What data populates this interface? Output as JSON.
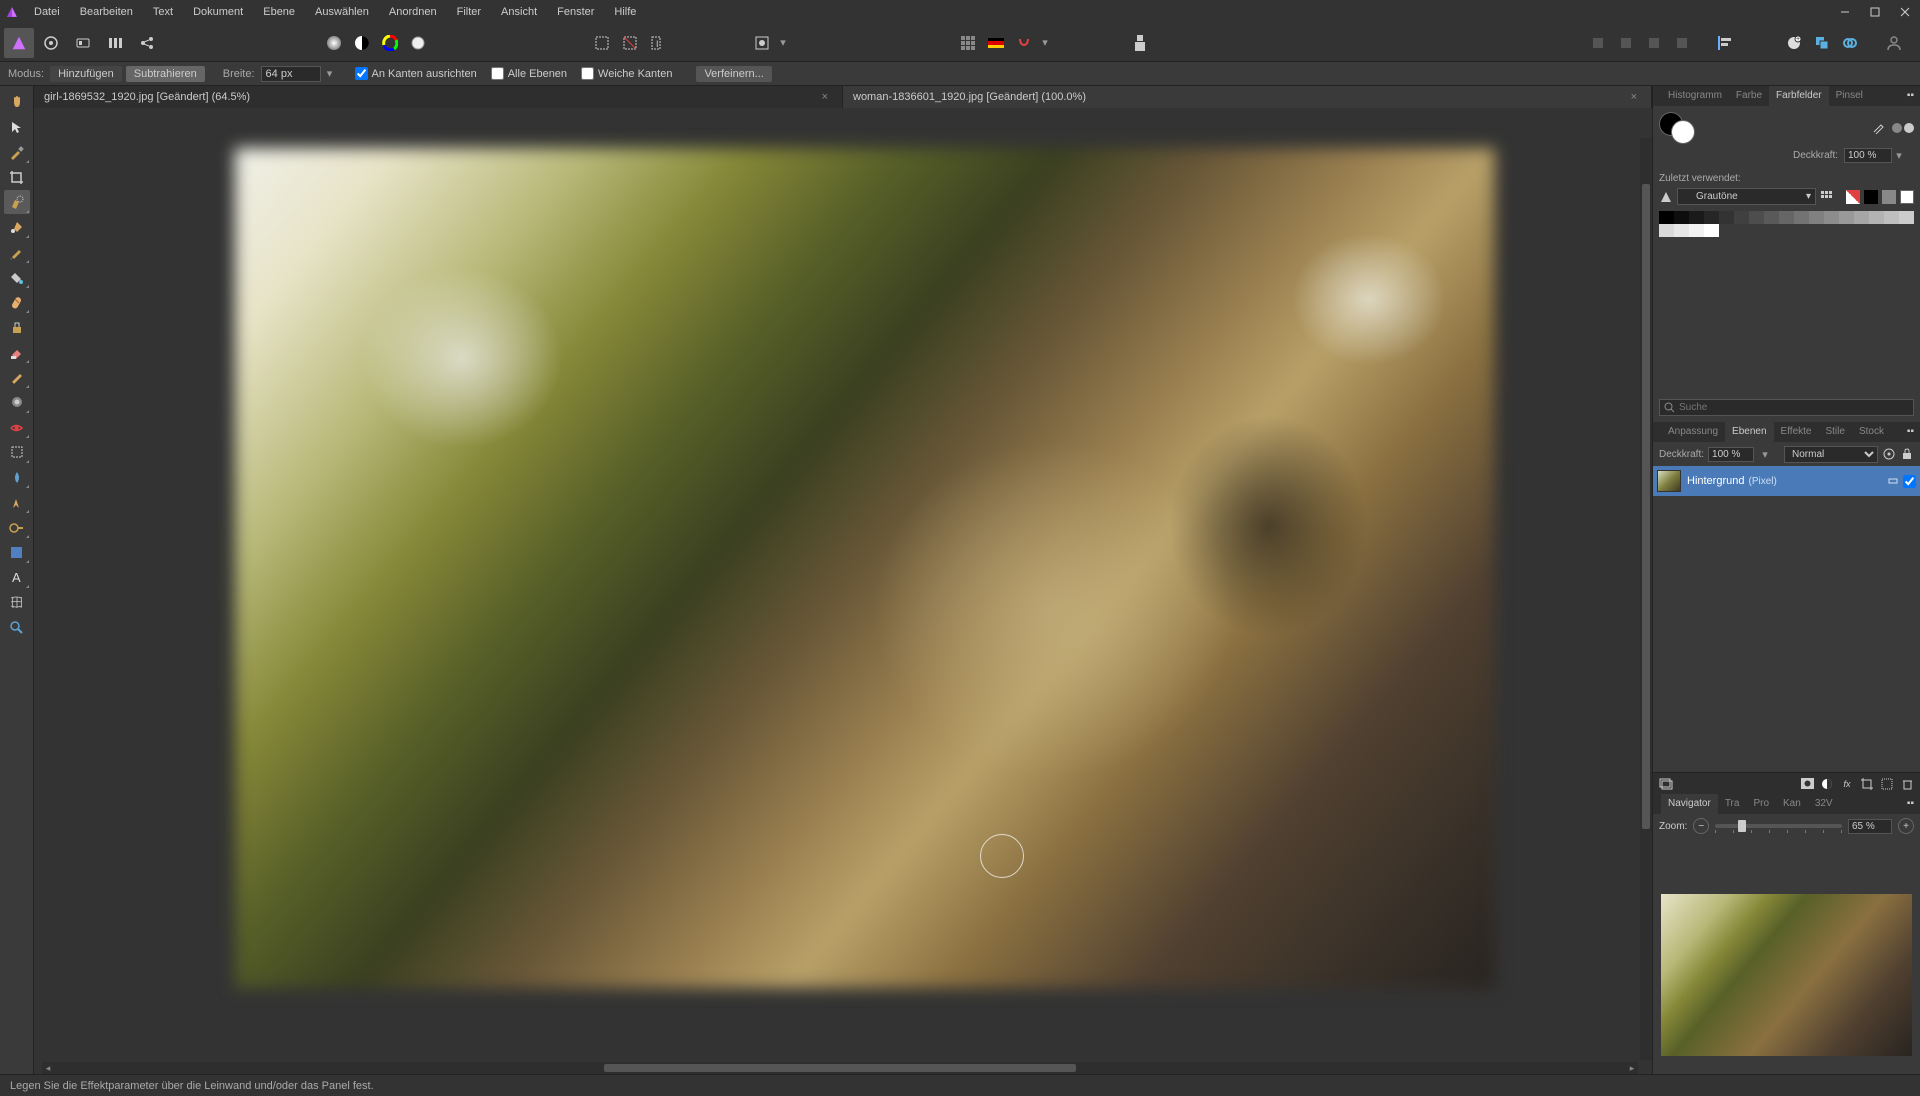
{
  "menu": [
    "Datei",
    "Bearbeiten",
    "Text",
    "Dokument",
    "Ebene",
    "Auswählen",
    "Anordnen",
    "Filter",
    "Ansicht",
    "Fenster",
    "Hilfe"
  ],
  "context": {
    "mode_label": "Modus:",
    "add": "Hinzufügen",
    "subtract": "Subtrahieren",
    "width_label": "Breite:",
    "width_value": "64 px",
    "snap_edges": "An Kanten ausrichten",
    "all_layers": "Alle Ebenen",
    "soft_edges": "Weiche Kanten",
    "refine": "Verfeinern..."
  },
  "tabs": [
    {
      "label": "girl-1869532_1920.jpg [Geändert] (64.5%)",
      "active": false
    },
    {
      "label": "woman-1836601_1920.jpg [Geändert] (100.0%)",
      "active": true
    }
  ],
  "right_tabs_top": [
    "Histogramm",
    "Farbe",
    "Farbfelder",
    "Pinsel"
  ],
  "right_tabs_top_active": "Farbfelder",
  "swatch": {
    "opacity_label": "Deckkraft:",
    "opacity_value": "100 %",
    "recent_label": "Zuletzt verwendet:",
    "palette_name": "Grautöne",
    "search_placeholder": "Suche"
  },
  "grays": [
    "#000000",
    "#0d0d0d",
    "#1a1a1a",
    "#262626",
    "#333333",
    "#404040",
    "#4d4d4d",
    "#595959",
    "#666666",
    "#737373",
    "#808080",
    "#8c8c8c",
    "#999999",
    "#a6a6a6",
    "#b3b3b3",
    "#bfbfbf",
    "#cccccc",
    "#d9d9d9",
    "#e6e6e6",
    "#f2f2f2",
    "#ffffff"
  ],
  "right_tabs_mid": [
    "Anpassung",
    "Ebenen",
    "Effekte",
    "Stile",
    "Stock"
  ],
  "right_tabs_mid_active": "Ebenen",
  "layers": {
    "opacity_label": "Deckkraft:",
    "opacity_value": "100 %",
    "blend_mode": "Normal",
    "items": [
      {
        "name": "Hintergrund",
        "type": "(Pixel)"
      }
    ]
  },
  "right_tabs_bot": [
    "Navigator",
    "Tra",
    "Pro",
    "Kan",
    "32V"
  ],
  "right_tabs_bot_active": "Navigator",
  "navigator": {
    "zoom_label": "Zoom:",
    "zoom_value": "65 %"
  },
  "status": "Legen Sie die Effektparameter über die Leinwand und/oder das Panel fest."
}
